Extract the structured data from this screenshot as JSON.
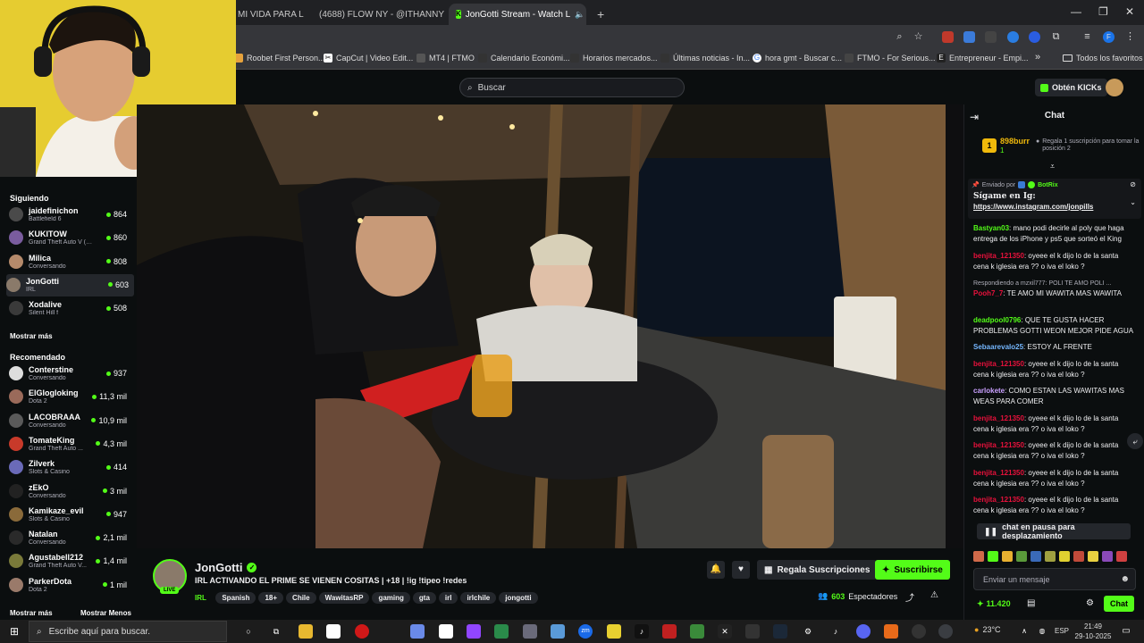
{
  "browser": {
    "tabs": [
      {
        "title": "MI VIDA PARA L",
        "active": false
      },
      {
        "title": "(4688) FLOW NY - @ITHANNY",
        "active": false
      },
      {
        "title": "JonGotti Stream - Watch L",
        "active": true
      }
    ],
    "new_tab": "+",
    "bookmarks": [
      "Roobet First Person...",
      "CapCut | Video Edit...",
      "MT4 | FTMO",
      "Calendario Económi...",
      "Horarios mercados...",
      "Últimas noticias - In...",
      "hora gmt - Buscar c...",
      "FTMO - For Serious...",
      "Entrepreneur - Empi...",
      "»",
      "Todos los favoritos"
    ]
  },
  "header": {
    "search_placeholder": "Buscar",
    "kicks_button": "Obtén KICKs"
  },
  "sidebar": {
    "following_title": "Siguiendo",
    "following": [
      {
        "name": "jaidefinichon",
        "category": "Battlefield 6",
        "viewers": "864",
        "color": "#4a4a4a"
      },
      {
        "name": "KUKITOW",
        "category": "Grand Theft Auto V (G...",
        "viewers": "860",
        "color": "#7a5c9e"
      },
      {
        "name": "Milica",
        "category": "Conversando",
        "viewers": "808",
        "color": "#b58a6b"
      },
      {
        "name": "JonGotti",
        "category": "IRL",
        "viewers": "603",
        "color": "#8a7a6a"
      },
      {
        "name": "Xodalive",
        "category": "Silent Hill f",
        "viewers": "508",
        "color": "#3a3a3a"
      }
    ],
    "show_more_1": "Mostrar más",
    "recommended_title": "Recomendado",
    "recommended": [
      {
        "name": "Conterstine",
        "category": "Conversando",
        "viewers": "937",
        "color": "#ddd"
      },
      {
        "name": "ElGlogloking",
        "category": "Dota 2",
        "viewers": "11,3 mil",
        "color": "#9a6a5a"
      },
      {
        "name": "LACOBRAAA",
        "category": "Conversando",
        "viewers": "10,9 mil",
        "color": "#5a5a5a"
      },
      {
        "name": "TomateKing",
        "category": "Grand Theft Auto ...",
        "viewers": "4,3 mil",
        "color": "#c83a2a"
      },
      {
        "name": "Zilverk",
        "category": "Slots & Casino",
        "viewers": "414",
        "color": "#6a6ab8"
      },
      {
        "name": "zEkO",
        "category": "Conversando",
        "viewers": "3 mil",
        "color": "#222"
      },
      {
        "name": "Kamikaze_evil",
        "category": "Slots & Casino",
        "viewers": "947",
        "color": "#8a6a3a"
      },
      {
        "name": "Natalan",
        "category": "Conversando",
        "viewers": "2,1 mil",
        "color": "#2a2a2a"
      },
      {
        "name": "Agustabell212",
        "category": "Grand Theft Auto V...",
        "viewers": "1,4 mil",
        "color": "#7a7a3a"
      },
      {
        "name": "ParkerDota",
        "category": "Dota 2",
        "viewers": "1 mil",
        "color": "#9a7a6a"
      }
    ],
    "show_more_2": "Mostrar más",
    "show_less": "Mostrar Menos"
  },
  "stream": {
    "channel": "JonGotti",
    "live_badge": "LIVE",
    "title": "IRL ACTIVANDO EL PRIME SE VIENEN COSITAS | +18 | !ig !tipeo !redes",
    "category": "IRL",
    "tags": [
      "Spanish",
      "18+",
      "Chile",
      "WawitasRP",
      "gaming",
      "gta",
      "irl",
      "irlchile",
      "jongotti"
    ],
    "gift_subs": "Regala Suscripciones",
    "subscribe": "Suscribirse",
    "viewers": "603",
    "viewers_label": "Espectadores"
  },
  "chat": {
    "title": "Chat",
    "top_gifter": {
      "name": "898burr",
      "count": "1",
      "rank": "1"
    },
    "gift_prompt": "Regala 1 suscripción para tomar la posición 2",
    "pinned_sent_by": "Enviado por",
    "pinned_bot": "BotRix",
    "pinned_title": "Sígame en Ig:",
    "pinned_link": "https://www.instagram.com/jonpills",
    "messages": [
      {
        "user": "Bastyan03",
        "color": "#53fc18",
        "text": "mano podi decirle al poly que haga entrega de los iPhone y ps5 que sorteó el King"
      },
      {
        "user": "benjita_121350",
        "color": "#e9113c",
        "text": "oyeee el k dijo lo de la santa cena k iglesia era ?? o iva el loko ?"
      },
      {
        "user": "Pooh7_7",
        "color": "#e9113c",
        "text": "TE AMO MI WAWITA MAS WAWITA",
        "reply": "Respondiendo a mzxil777: POLI TE AMO POLI ..."
      },
      {
        "user": "deadpool0796",
        "color": "#53fc18",
        "text": "QUE TE GUSTA HACER PROBLEMAS GOTTI WEON MEJOR PIDE AGUA"
      },
      {
        "user": "Sebaarevalo25",
        "color": "#75b7ff",
        "text": "ESTOY AL FRENTE"
      },
      {
        "user": "benjita_121350",
        "color": "#e9113c",
        "text": "oyeee el k dijo lo de la santa cena k iglesia era ?? o iva el loko ?"
      },
      {
        "user": "carlokete",
        "color": "#c9a0ff",
        "text": "COMO ESTAN LAS WAWITAS MAS WEAS PARA COMER"
      },
      {
        "user": "benjita_121350",
        "color": "#e9113c",
        "text": "oyeee el k dijo lo de la santa cena k iglesia era ?? o iva el loko ?"
      },
      {
        "user": "benjita_121350",
        "color": "#e9113c",
        "text": "oyeee el k dijo lo de la santa cena k iglesia era ?? o iva el loko ?"
      },
      {
        "user": "benjita_121350",
        "color": "#e9113c",
        "text": "oyeee el k dijo lo de la santa cena k iglesia era ?? o iva el loko ?"
      },
      {
        "user": "benjita_121350",
        "color": "#e9113c",
        "text": "oyeee el k dijo lo de la santa cena k iglesia era ?? o iva el loko ?"
      }
    ],
    "paused": "chat en pausa para desplazamiento",
    "input_placeholder": "Enviar un mensaje",
    "points": "11.420",
    "send_button": "Chat"
  },
  "taskbar": {
    "search_placeholder": "Escribe aquí para buscar.",
    "temperature": "23°C",
    "language": "ESP",
    "time": "21:49",
    "date": "29-10-2025"
  },
  "colors": {
    "accent": "#53fc18",
    "bg": "#0b0e0f"
  }
}
